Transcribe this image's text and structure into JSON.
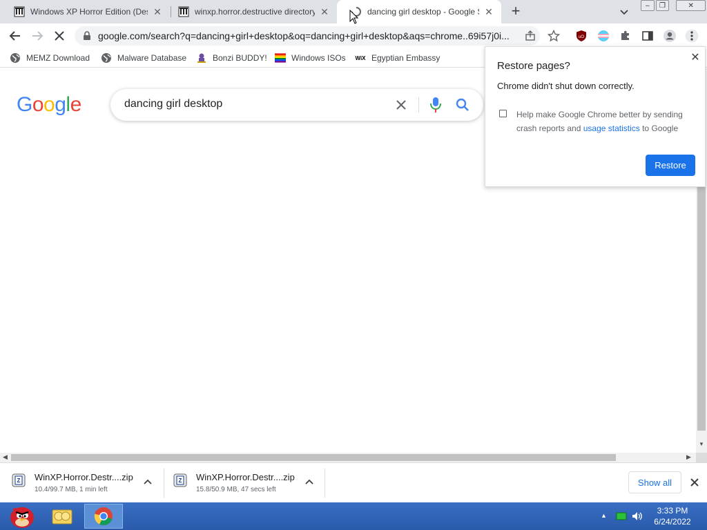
{
  "tabs": [
    {
      "title": "Windows XP Horror Edition (Destructive",
      "icon": "museum-icon",
      "active": false
    },
    {
      "title": "winxp.horror.destructive directory",
      "icon": "museum-icon",
      "active": false
    },
    {
      "title": "dancing girl desktop - Google Search",
      "icon": "loading-spinner-icon",
      "active": true
    }
  ],
  "window_controls": {
    "minimize": "‒",
    "restore": "❐",
    "close": "✕"
  },
  "omnibox": {
    "url": "google.com/search?q=dancing+girl+desktop&oq=dancing+girl+desktop&aqs=chrome..69i57j0i..."
  },
  "bookmarks": [
    {
      "label": "MEMZ Download",
      "icon": "globe-icon"
    },
    {
      "label": "Malware Database",
      "icon": "globe-icon"
    },
    {
      "label": "Bonzi BUDDY!",
      "icon": "bonzi-icon"
    },
    {
      "label": "Windows ISOs",
      "icon": "rainbow-flag-icon"
    },
    {
      "label": "Egyptian Embassy",
      "icon": "wix-icon"
    }
  ],
  "search": {
    "query": "dancing girl desktop"
  },
  "popup": {
    "title": "Restore pages?",
    "message": "Chrome didn't shut down correctly.",
    "checkbox_text_before": "Help make Google Chrome better by sending crash reports and ",
    "checkbox_link": "usage statistics",
    "checkbox_text_after": " to Google",
    "checked": false,
    "button": "Restore"
  },
  "downloads": [
    {
      "name": "WinXP.Horror.Destr....zip",
      "status": "10.4/99.7 MB, 1 min left"
    },
    {
      "name": "WinXP.Horror.Destr....zip",
      "status": "15.8/50.9 MB, 47 secs left"
    }
  ],
  "shelf": {
    "show_all": "Show all"
  },
  "taskbar": {
    "apps": [
      "angry-birds-icon",
      "folder-icon",
      "chrome-icon"
    ],
    "time": "3:33 PM",
    "date": "6/24/2022"
  },
  "colors": {
    "accent": "#1a73e8",
    "taskbar": "#2a5aaa"
  }
}
